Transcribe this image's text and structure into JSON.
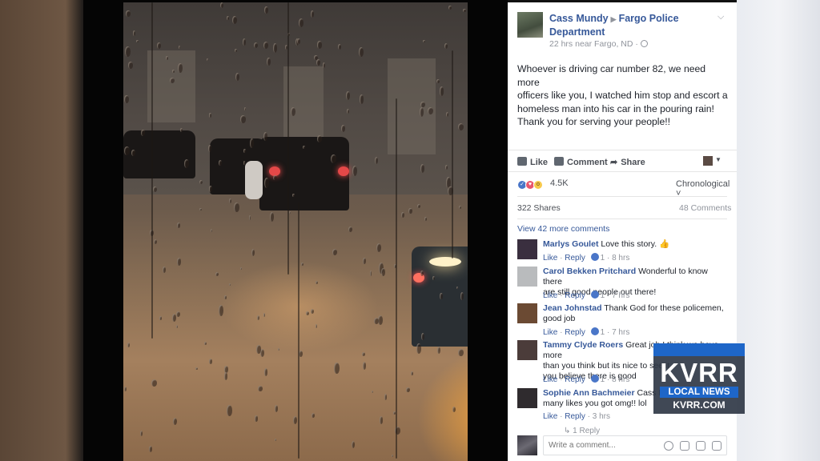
{
  "post": {
    "author": "Cass Mundy",
    "target": "Fargo Police Department",
    "meta": "22 hrs near Fargo, ND ·",
    "text_lines": [
      "Whoever is driving car number 82, we need more",
      "officers like you, I watched him stop and escort a",
      "homeless man into his car in the pouring rain!",
      "Thank you for serving your people!!"
    ]
  },
  "actions": {
    "like": "Like",
    "comment": "Comment",
    "share": "Share"
  },
  "stats": {
    "reactions": "4.5K",
    "sort": "Chronological ˅",
    "shares": "322 Shares",
    "comments": "48 Comments",
    "more_comments": "View 42 more comments"
  },
  "comments": [
    {
      "name": "Marlys Goulet",
      "lines": [
        "Love this story. 👍"
      ],
      "likes": "1",
      "time": "8 hrs",
      "avatar_color": "#3a2f3f"
    },
    {
      "name": "Carol Bekken Pritchard",
      "lines": [
        "Wonderful to know there",
        "are still good people out there!"
      ],
      "likes": "1",
      "time": "7 hrs",
      "avatar_color": "#b9bbbd"
    },
    {
      "name": "Jean Johnstad",
      "lines": [
        "Thank God for these policemen,",
        "good job"
      ],
      "likes": "1",
      "time": "7 hrs",
      "avatar_color": "#6b4a33"
    },
    {
      "name": "Tammy Clyde Roers",
      "lines": [
        "Great job I think we have more",
        "than you think but its nice to see it",
        "you believe there is good"
      ],
      "likes": "1",
      "time": "8 hrs",
      "avatar_color": "#4b3c3a"
    },
    {
      "name": "Sophie Ann Bachmeier",
      "lines": [
        "Cass Mundy",
        "many likes you got omg!! lol"
      ],
      "likes": "",
      "time": "3 hrs",
      "avatar_color": "#2f2b2e"
    }
  ],
  "comment_actions": {
    "like": "Like",
    "reply": "Reply",
    "sep": "·"
  },
  "partial_reply": "↳ 1 Reply",
  "compose": {
    "placeholder": "Write a comment..."
  },
  "watermark": {
    "logo": "KVRR",
    "subtitle": "LOCAL NEWS",
    "url": "KVRR.COM"
  },
  "colors": {
    "fb_link": "#365899",
    "fb_blue": "#4a76c8",
    "love": "#e9566d",
    "wow": "#f7c94b",
    "kvrr_blue": "#1e66c8"
  }
}
